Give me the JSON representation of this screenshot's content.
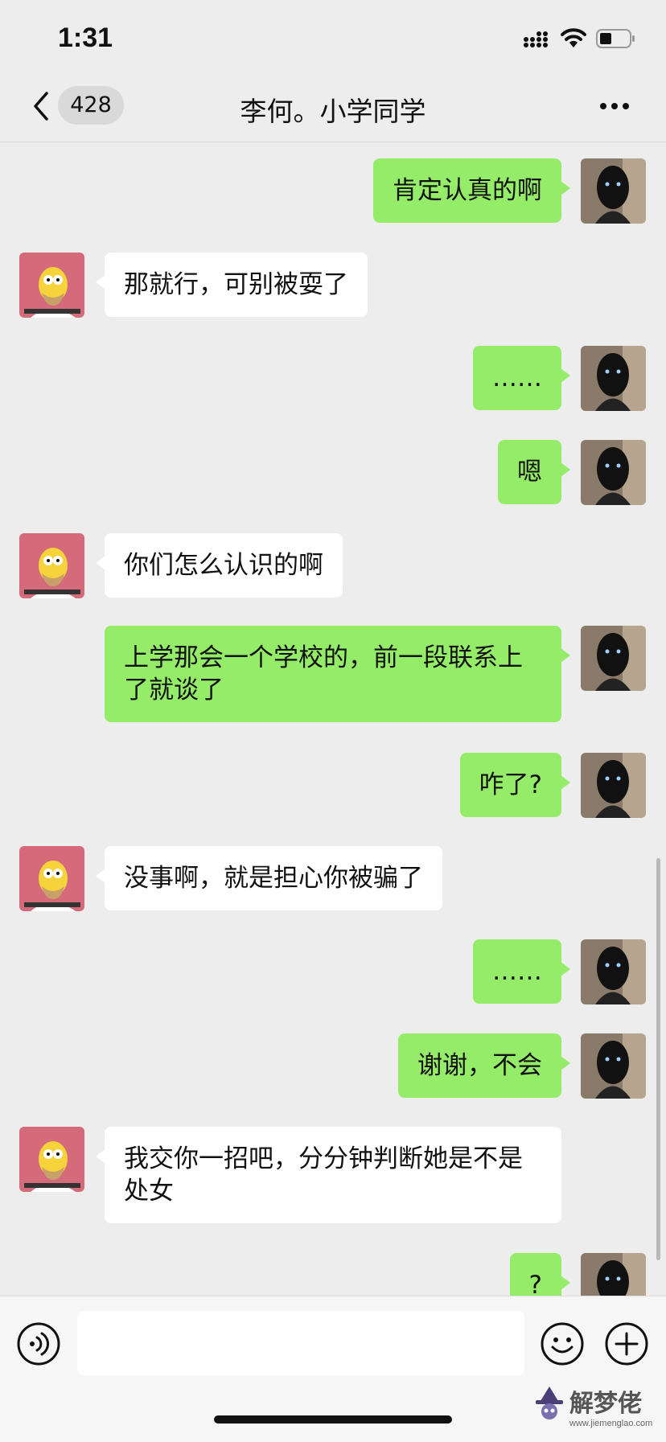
{
  "status_bar": {
    "time": "1:31"
  },
  "header": {
    "unread_count": "428",
    "title": "李何。小学同学"
  },
  "messages": [
    {
      "sender": "me",
      "text": "肯定认真的啊"
    },
    {
      "sender": "other",
      "text": "那就行，可别被耍了"
    },
    {
      "sender": "me",
      "text": "……"
    },
    {
      "sender": "me",
      "text": "嗯"
    },
    {
      "sender": "other",
      "text": "你们怎么认识的啊"
    },
    {
      "sender": "me",
      "text": "上学那会一个学校的，前一段联系上了就谈了"
    },
    {
      "sender": "me",
      "text": "咋了?"
    },
    {
      "sender": "other",
      "text": "没事啊，就是担心你被骗了"
    },
    {
      "sender": "me",
      "text": "……"
    },
    {
      "sender": "me",
      "text": "谢谢，不会"
    },
    {
      "sender": "other",
      "text": "我交你一招吧，分分钟判断她是不是处女"
    },
    {
      "sender": "me",
      "text": "?"
    }
  ],
  "input": {
    "value": "",
    "placeholder": ""
  },
  "watermark": {
    "name": "解梦佬",
    "url": "www.jiemenglao.com"
  },
  "icons": [
    "back-icon",
    "more-icon",
    "voice-icon",
    "emoji-icon",
    "add-icon",
    "signal-icon",
    "wifi-icon",
    "battery-icon"
  ],
  "colors": {
    "background": "#ededed",
    "my_bubble": "#95ec69",
    "their_bubble": "#ffffff",
    "input_bar": "#f6f6f6"
  }
}
